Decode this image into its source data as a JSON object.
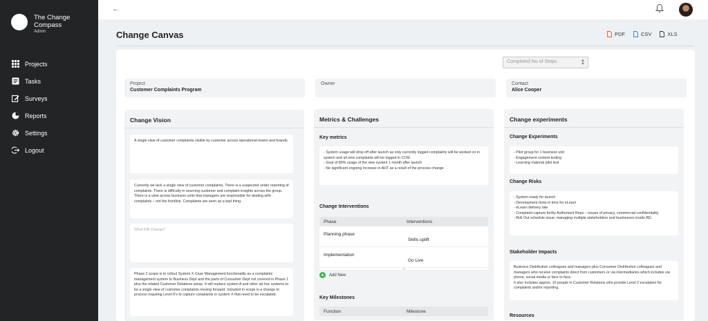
{
  "sidebar": {
    "brand_name": "The Change Compass",
    "brand_role": "Admin",
    "items": [
      {
        "label": "Projects",
        "icon": "grid-icon"
      },
      {
        "label": "Tasks",
        "icon": "list-icon"
      },
      {
        "label": "Surveys",
        "icon": "edit-icon"
      },
      {
        "label": "Reports",
        "icon": "pie-chart-icon"
      },
      {
        "label": "Settings",
        "icon": "gear-icon"
      },
      {
        "label": "Logout",
        "icon": "logout-icon"
      }
    ]
  },
  "header": {
    "title": "Change Canvas",
    "exports": [
      "PDF",
      "CSV",
      "XLS"
    ],
    "steps_select": "Completed No of Steps"
  },
  "info": {
    "project_label": "Project",
    "project_value": "Customer Complaints Program",
    "owner_label": "Owner",
    "owner_value": "",
    "contact_label": "Contact",
    "contact_value": "Alice Cooper"
  },
  "vision": {
    "title": "Change Vision",
    "cards": [
      "A single view of customer complaints visible by customer across operational teams and brands.",
      "Currently we lack a single view of customer complaints, There is a suspected under reporting of complaints.  There is difficulty in sourcing customer and complaint insights across the group.  There is a view across business units that managers are responsible for dealing with complaints – not the frontline.  Complaints are seen as a bad thing.",
      "What Will Change?",
      "Phase 2 scope is to rollout System X Case Management functionality as a complaints management system to Business Dept and the parts of Consumer Dept not covered in Phase 1 plus the related Customer Relations areas.  It will replace system A and other ad hoc systems to be a single view of customer complaints moving forward.  Included in scope is a change to process requiring Level 0's to capture complaints in system X that need to be escalated."
    ]
  },
  "metrics": {
    "title": "Metrics & Challenges",
    "key_metrics_title": "Key metrics",
    "key_metrics": "- System usage will drop off after launch as only currently logged complaints will be worked on in system and all new complaints will be logged in CCM.\n- Goal of 80% usage of the new system 1 month after launch\n- No significant ongoing increase in AHT as a result of the process change",
    "interventions_title": "Change Interventions",
    "interventions_head": [
      "Phase",
      "Interventions"
    ],
    "interventions_rows": [
      {
        "phase": "Planning phase",
        "intervention": "Skills uplift"
      },
      {
        "phase": "Implementation",
        "intervention": "Go Live"
      }
    ],
    "add_new": "Add New",
    "milestones_title": "Key Milestones",
    "milestones_head": [
      "Function",
      "Milestone"
    ]
  },
  "experiments": {
    "title": "Change experiments",
    "experiments_title": "Change Experiments",
    "experiments": "- Pilot group for 1 business unit\n- Engagement content testing\n- Learning material pilot test",
    "risks_title": "Change Risks",
    "risks": "- System ready for launch\n- Development done in time for eLearn\n- eLearn delivery late\n- Complaint capture for/by Authorised Reps – issues of privacy, commercial confidentiality\n- Roll Out schedule issue; managing multiple stakeholders and businesses inside BD.",
    "impacts_title": "Stakeholder Impacts",
    "impacts": "Business Distribution colleagues and managers plus Consumer Distribution colleagues and managers who receive complaints direct from customers or via intermediaries which includes via phone, social media or face to face.\nIt also includes approx. 10 people in Customer Relations who provide Level 2 escalation for complaints and/or reporting.",
    "resources_title": "Resources"
  }
}
